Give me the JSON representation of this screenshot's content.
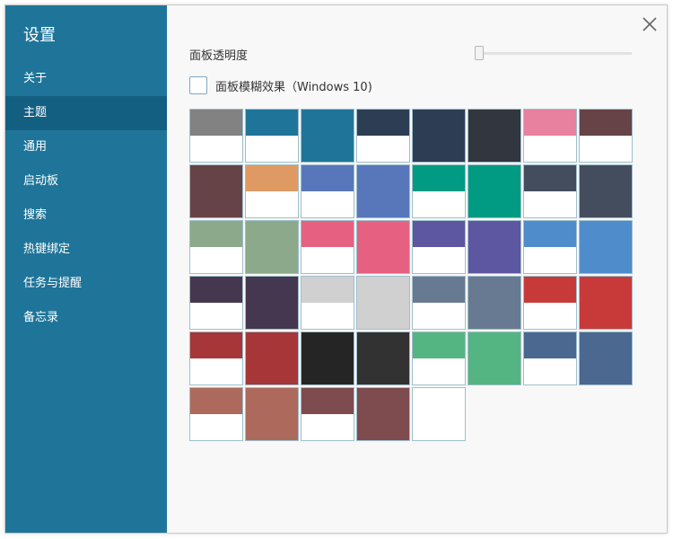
{
  "window": {
    "title": "设置",
    "close_icon": "close-icon"
  },
  "sidebar": {
    "items": [
      {
        "label": "关于",
        "active": false
      },
      {
        "label": "主题",
        "active": true
      },
      {
        "label": "通用",
        "active": false
      },
      {
        "label": "启动板",
        "active": false
      },
      {
        "label": "搜索",
        "active": false
      },
      {
        "label": "热键绑定",
        "active": false
      },
      {
        "label": "任务与提醒",
        "active": false
      },
      {
        "label": "备忘录",
        "active": false
      }
    ]
  },
  "theme": {
    "opacity_label": "面板透明度",
    "opacity_value": 0,
    "blur_label": "面板模糊效果（Windows 10)",
    "blur_checked": false,
    "swatches": [
      {
        "color": "#828282",
        "style": "split"
      },
      {
        "color": "#1f7599",
        "style": "split"
      },
      {
        "color": "#1f7599",
        "style": "full"
      },
      {
        "color": "#2d3d54",
        "style": "split"
      },
      {
        "color": "#2d3d54",
        "style": "full"
      },
      {
        "color": "#32363e",
        "style": "full"
      },
      {
        "color": "#e8809f",
        "style": "split"
      },
      {
        "color": "#654346",
        "style": "split"
      },
      {
        "color": "#654346",
        "style": "full"
      },
      {
        "color": "#df9a63",
        "style": "split"
      },
      {
        "color": "#5877ba",
        "style": "split"
      },
      {
        "color": "#5877ba",
        "style": "full"
      },
      {
        "color": "#009b82",
        "style": "split"
      },
      {
        "color": "#009b82",
        "style": "full"
      },
      {
        "color": "#434d5e",
        "style": "split"
      },
      {
        "color": "#434d5e",
        "style": "full"
      },
      {
        "color": "#8ca98c",
        "style": "split"
      },
      {
        "color": "#8ca98c",
        "style": "full"
      },
      {
        "color": "#e66181",
        "style": "split"
      },
      {
        "color": "#e66181",
        "style": "full"
      },
      {
        "color": "#5c57a0",
        "style": "split"
      },
      {
        "color": "#5c57a0",
        "style": "full"
      },
      {
        "color": "#4f8ccb",
        "style": "split"
      },
      {
        "color": "#4f8ccb",
        "style": "full"
      },
      {
        "color": "#45374f",
        "style": "split"
      },
      {
        "color": "#45374f",
        "style": "full"
      },
      {
        "color": "#d0d0d0",
        "style": "split"
      },
      {
        "color": "#d0d0d0",
        "style": "full"
      },
      {
        "color": "#687a91",
        "style": "split"
      },
      {
        "color": "#687a91",
        "style": "full"
      },
      {
        "color": "#c83a3a",
        "style": "split"
      },
      {
        "color": "#c83a3a",
        "style": "full"
      },
      {
        "color": "#a73638",
        "style": "split"
      },
      {
        "color": "#a73638",
        "style": "full"
      },
      {
        "color": "#252525",
        "style": "full"
      },
      {
        "color": "#323232",
        "style": "full"
      },
      {
        "color": "#55b582",
        "style": "split"
      },
      {
        "color": "#55b582",
        "style": "full"
      },
      {
        "color": "#4a6890",
        "style": "split"
      },
      {
        "color": "#4a6890",
        "style": "full"
      },
      {
        "color": "#ad6a5c",
        "style": "split"
      },
      {
        "color": "#ad6a5c",
        "style": "full"
      },
      {
        "color": "#7e4b4f",
        "style": "split"
      },
      {
        "color": "#7e4b4f",
        "style": "full"
      },
      {
        "color": "#ffffff",
        "style": "full"
      }
    ]
  }
}
